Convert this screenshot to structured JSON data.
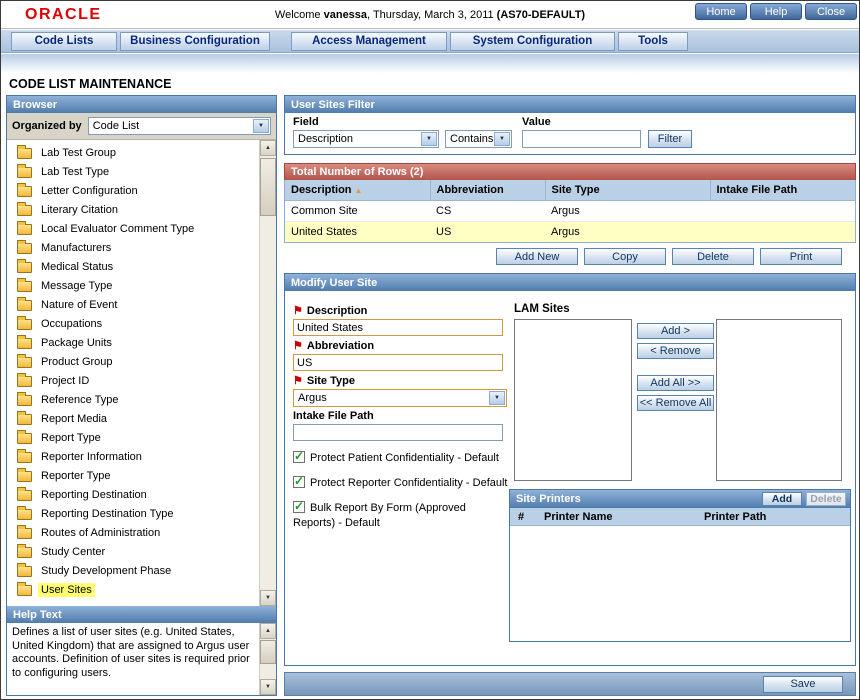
{
  "header": {
    "logo": "ORACLE",
    "welcome_prefix": "Welcome ",
    "username": "vanessa",
    "welcome_middle": ", Thursday, March 3, 2011 ",
    "server": "(AS70-DEFAULT)",
    "home_button": "Home",
    "help_button": "Help",
    "close_button": "Close"
  },
  "nav": {
    "tabs": [
      "Code Lists",
      "Business Configuration",
      "Access Management",
      "System Configuration",
      "Tools"
    ]
  },
  "page_title": "CODE LIST MAINTENANCE",
  "browser": {
    "title": "Browser",
    "organized_by_label": "Organized by",
    "organized_by_value": "Code List",
    "items": [
      "Lab Test Group",
      "Lab Test Type",
      "Letter Configuration",
      "Literary Citation",
      "Local Evaluator Comment Type",
      "Manufacturers",
      "Medical Status",
      "Message Type",
      "Nature of Event",
      "Occupations",
      "Package Units",
      "Product Group",
      "Project ID",
      "Reference Type",
      "Report Media",
      "Report Type",
      "Reporter Information",
      "Reporter Type",
      "Reporting Destination",
      "Reporting Destination Type",
      "Routes of Administration",
      "Study Center",
      "Study Development Phase",
      "User Sites"
    ],
    "selected_item": "User Sites"
  },
  "help": {
    "title": "Help Text",
    "body": "Defines a list of user sites (e.g. United States, United Kingdom) that are assigned to Argus user accounts. Definition of user sites is required prior to configuring users."
  },
  "filter": {
    "title": "User Sites Filter",
    "field_label": "Field",
    "value_label": "Value",
    "field_value": "Description",
    "operator_value": "Contains",
    "value": "",
    "filter_button": "Filter"
  },
  "results": {
    "title": "Total Number of Rows (2)",
    "columns": [
      "Description",
      "Abbreviation",
      "Site Type",
      "Intake File Path"
    ],
    "rows": [
      {
        "description": "Common Site",
        "abbreviation": "CS",
        "site_type": "Argus",
        "intake_file_path": ""
      },
      {
        "description": "United States",
        "abbreviation": "US",
        "site_type": "Argus",
        "intake_file_path": ""
      }
    ],
    "selected_row_index": 1,
    "add_new_button": "Add New",
    "copy_button": "Copy",
    "delete_button": "Delete",
    "print_button": "Print"
  },
  "modify": {
    "title": "Modify User Site",
    "description_label": "Description",
    "description_value": "United States",
    "abbreviation_label": "Abbreviation",
    "abbreviation_value": "US",
    "site_type_label": "Site Type",
    "site_type_value": "Argus",
    "intake_label": "Intake File Path",
    "intake_value": "",
    "checkboxes": [
      "Protect Patient Confidentiality - Default",
      "Protect Reporter Confidentiality - Default",
      "Bulk Report By Form (Approved Reports) - Default"
    ],
    "lam_sites_label": "LAM Sites",
    "lam_add_button": "Add >",
    "lam_remove_button": "< Remove",
    "lam_add_all_button": "Add All >>",
    "lam_remove_all_button": "<< Remove All",
    "printers": {
      "title": "Site Printers",
      "add_button": "Add",
      "delete_button": "Delete",
      "col_num": "#",
      "col_name": "Printer Name",
      "col_path": "Printer Path"
    }
  },
  "footer": {
    "save_button": "Save"
  },
  "colors": {
    "oracle_red": "#e00000",
    "panel_header_blue": "#4f7bab",
    "rows_header_red": "#b2544b",
    "selected_row_yellow": "#ffffc4",
    "table_header_blue": "#bad0e6"
  }
}
